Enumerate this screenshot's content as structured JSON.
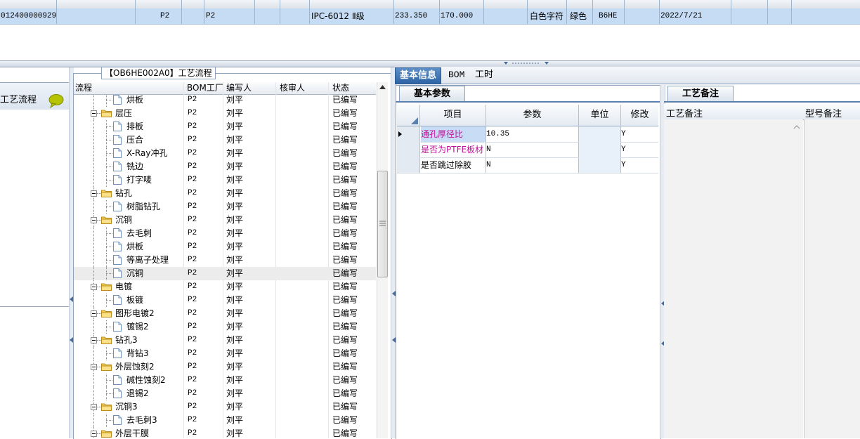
{
  "top_grid": {
    "row": {
      "id": "012400000929",
      "layer_a": "P2",
      "layer_b": "P2",
      "grade": "IPC-6012 Ⅱ级",
      "num1": "233.350",
      "num2": "170.000",
      "silkscreen": "白色字符",
      "soldermask": "绿色",
      "code": "B6HE",
      "date": "2022/7/21"
    }
  },
  "left_panel": {
    "title": "工艺流程"
  },
  "process": {
    "title": "【OB6HE002A0】工艺流程",
    "columns": {
      "flow": "流程",
      "bom_factory": "BOM工厂",
      "writer": "编写人",
      "reviewer": "核审人",
      "status": "状态"
    },
    "rows": [
      {
        "name": "烘板",
        "level": 1,
        "bom": "P2",
        "writer": "刘平",
        "status": "已编写"
      },
      {
        "name": "层压",
        "level": 0,
        "bom": "P2",
        "writer": "刘平",
        "status": "已编写"
      },
      {
        "name": "排板",
        "level": 1,
        "bom": "P2",
        "writer": "刘平",
        "status": "已编写"
      },
      {
        "name": "压合",
        "level": 1,
        "bom": "P2",
        "writer": "刘平",
        "status": "已编写"
      },
      {
        "name": "X-Ray冲孔",
        "level": 1,
        "bom": "P2",
        "writer": "刘平",
        "status": "已编写"
      },
      {
        "name": "铣边",
        "level": 1,
        "bom": "P2",
        "writer": "刘平",
        "status": "已编写"
      },
      {
        "name": "打字唛",
        "level": 1,
        "bom": "P2",
        "writer": "刘平",
        "status": "已编写"
      },
      {
        "name": "钻孔",
        "level": 0,
        "bom": "P2",
        "writer": "刘平",
        "status": "已编写"
      },
      {
        "name": "树脂钻孔",
        "level": 1,
        "bom": "P2",
        "writer": "刘平",
        "status": "已编写"
      },
      {
        "name": "沉铜",
        "level": 0,
        "bom": "P2",
        "writer": "刘平",
        "status": "已编写"
      },
      {
        "name": "去毛刺",
        "level": 1,
        "bom": "P2",
        "writer": "刘平",
        "status": "已编写"
      },
      {
        "name": "烘板",
        "level": 1,
        "bom": "P2",
        "writer": "刘平",
        "status": "已编写"
      },
      {
        "name": "等离子处理",
        "level": 1,
        "bom": "P2",
        "writer": "刘平",
        "status": "已编写"
      },
      {
        "name": "沉铜",
        "level": 1,
        "bom": "P2",
        "writer": "刘平",
        "status": "已编写",
        "selected": true
      },
      {
        "name": "电镀",
        "level": 0,
        "bom": "P2",
        "writer": "刘平",
        "status": "已编写"
      },
      {
        "name": "板镀",
        "level": 1,
        "bom": "P2",
        "writer": "刘平",
        "status": "已编写"
      },
      {
        "name": "图形电镀2",
        "level": 0,
        "bom": "P2",
        "writer": "刘平",
        "status": "已编写"
      },
      {
        "name": "镀锡2",
        "level": 1,
        "bom": "P2",
        "writer": "刘平",
        "status": "已编写"
      },
      {
        "name": "钻孔3",
        "level": 0,
        "bom": "P2",
        "writer": "刘平",
        "status": "已编写"
      },
      {
        "name": "背钻3",
        "level": 1,
        "bom": "P2",
        "writer": "刘平",
        "status": "已编写"
      },
      {
        "name": "外层蚀刻2",
        "level": 0,
        "bom": "P2",
        "writer": "刘平",
        "status": "已编写"
      },
      {
        "name": "碱性蚀刻2",
        "level": 1,
        "bom": "P2",
        "writer": "刘平",
        "status": "已编写"
      },
      {
        "name": "退锡2",
        "level": 1,
        "bom": "P2",
        "writer": "刘平",
        "status": "已编写"
      },
      {
        "name": "沉铜3",
        "level": 0,
        "bom": "P2",
        "writer": "刘平",
        "status": "已编写"
      },
      {
        "name": "去毛刺3",
        "level": 1,
        "bom": "P2",
        "writer": "刘平",
        "status": "已编写"
      },
      {
        "name": "外层干膜",
        "level": 0,
        "bom": "P2",
        "writer": "刘平",
        "status": "已编写"
      }
    ]
  },
  "tabs": [
    {
      "label": "基本信息",
      "active": true
    },
    {
      "label": "BOM",
      "active": false
    },
    {
      "label": "工时",
      "active": false
    }
  ],
  "basic_params": {
    "tab_label": "基本参数",
    "columns": {
      "item": "项目",
      "param": "参数",
      "unit": "单位",
      "modify": "修改"
    },
    "rows": [
      {
        "item": "通孔厚径比",
        "param": "10.35",
        "unit": "",
        "modify": "Y",
        "color": "#c0109a",
        "current": true
      },
      {
        "item": "是否为PTFE板材",
        "param": "N",
        "unit": "",
        "modify": "Y",
        "color": "#c0109a",
        "current": false
      },
      {
        "item": "是否跳过除胶",
        "param": "N",
        "unit": "",
        "modify": "Y",
        "color": "#000000",
        "current": false
      }
    ]
  },
  "remarks": {
    "tab_label": "工艺备注",
    "col1": "工艺备注",
    "col2": "型号备注"
  }
}
